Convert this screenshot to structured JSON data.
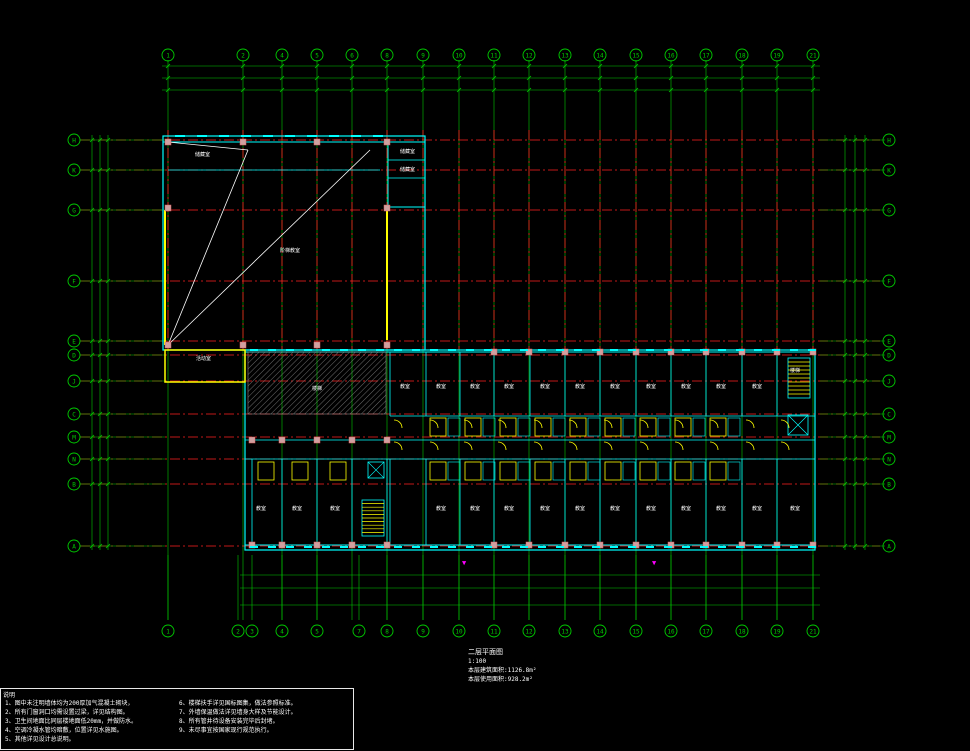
{
  "drawing": {
    "background": "#000000",
    "colors": {
      "grid": "#00cc00",
      "axis_dash": "#ff2020",
      "wall": "#00ffff",
      "column": "#d0a0a0",
      "highlight": "#ffff00",
      "text": "#ffffff",
      "marker": "#ff00ff"
    },
    "top_axes": [
      "1",
      "2",
      "4",
      "5",
      "6",
      "8",
      "9",
      "10",
      "11",
      "12",
      "13",
      "14",
      "15",
      "16",
      "17",
      "18",
      "19",
      "21"
    ],
    "bottom_axes": [
      "1",
      "2",
      "3",
      "4",
      "5",
      "7",
      "8",
      "9",
      "10",
      "11",
      "12",
      "13",
      "14",
      "15",
      "16",
      "17",
      "18",
      "19",
      "21"
    ],
    "side_axes": [
      "H",
      "K",
      "G",
      "F",
      "E",
      "D",
      "J",
      "C",
      "M",
      "N",
      "B",
      "A"
    ],
    "room_labels": [
      "储藏室",
      "楼梯",
      "阶梯教室",
      "教室",
      "教室",
      "活动室"
    ],
    "title": "二层平面图",
    "scale": "1:100",
    "area_lines": [
      "本层建筑面积:1126.8m²",
      "本层使用面积:928.2m²"
    ]
  },
  "notes": {
    "title": "说明",
    "left": [
      "1、图中未注明墙体均为200厚加气混凝土砌块，",
      "2、所有门窗洞口均需设置过梁，详见结构图。",
      "3、卫生间地面比同层楼地面低20mm，并做防水。",
      "4、空调冷凝水管均暗敷，位置详见水施图。",
      "5、其他详见设计总说明。"
    ],
    "right": [
      "6、楼梯扶手详见国标图集，做法参照标准。",
      "7、外墙保温做法详见墙身大样及节能设计。",
      "8、所有管井待设备安装完毕后封堵。",
      "9、未尽事宜按国家现行规范执行。"
    ]
  }
}
